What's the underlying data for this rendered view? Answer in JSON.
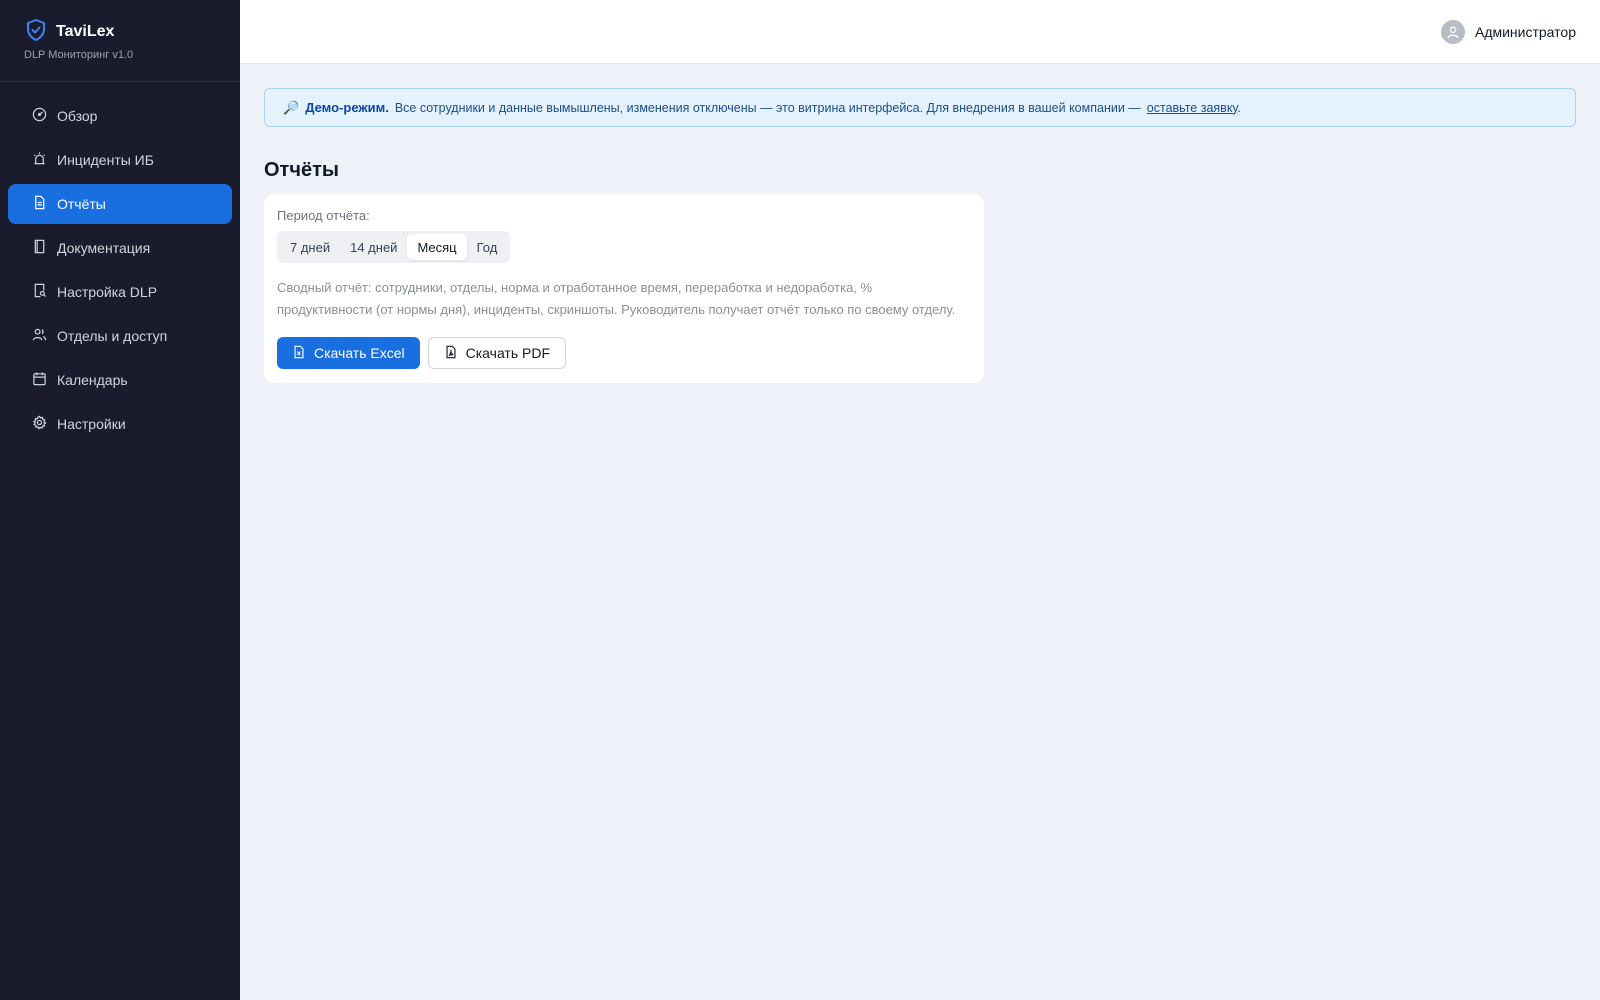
{
  "brand": {
    "name": "TaviLex",
    "subtitle": "DLP Мониторинг v1.0",
    "icon": "shield-check-icon"
  },
  "sidebar": {
    "items": [
      {
        "label": "Обзор",
        "icon": "dashboard-gauge-icon",
        "active": false
      },
      {
        "label": "Инциденты ИБ",
        "icon": "alarm-siren-icon",
        "active": false
      },
      {
        "label": "Отчёты",
        "icon": "document-icon",
        "active": true
      },
      {
        "label": "Документация",
        "icon": "book-icon",
        "active": false
      },
      {
        "label": "Настройка DLP",
        "icon": "file-search-icon",
        "active": false
      },
      {
        "label": "Отделы и доступ",
        "icon": "users-icon",
        "active": false
      },
      {
        "label": "Календарь",
        "icon": "calendar-icon",
        "active": false
      },
      {
        "label": "Настройки",
        "icon": "gear-icon",
        "active": false
      }
    ]
  },
  "header": {
    "user_name": "Администратор",
    "avatar_icon": "user-icon"
  },
  "banner": {
    "emoji": "🔎",
    "bold": "Демо-режим.",
    "text": "Все сотрудники и данные вымышлены, изменения отключены — это витрина интерфейса. Для внедрения в вашей компании —",
    "link": "оставьте заявку",
    "tail": "."
  },
  "page": {
    "title": "Отчёты"
  },
  "report": {
    "period_label": "Период отчёта:",
    "periods": [
      {
        "label": "7 дней",
        "active": false
      },
      {
        "label": "14 дней",
        "active": false
      },
      {
        "label": "Месяц",
        "active": true
      },
      {
        "label": "Год",
        "active": false
      }
    ],
    "description": "Сводный отчёт: сотрудники, отделы, норма и отработанное время, переработка и недоработка, % продуктивности (от нормы дня), инциденты, скриншоты. Руководитель получает отчёт только по своему отделу.",
    "excel_button": "Скачать Excel",
    "pdf_button": "Скачать PDF"
  },
  "colors": {
    "sidebar_bg": "#1b1b2e",
    "accent": "#1a6fe0",
    "page_bg": "#eef2f8",
    "banner_bg": "#e3f2fd"
  }
}
